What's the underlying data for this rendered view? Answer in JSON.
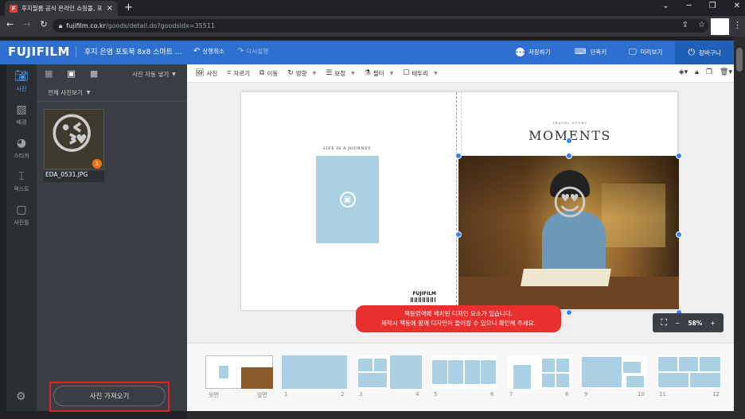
{
  "browser": {
    "tab_title": "후지필름 공식 온라인 쇼핑몰, 포",
    "tab_favicon": "F",
    "tab_close": "×",
    "new_tab": "+",
    "url_domain": "fujifilm.co.kr",
    "url_path": "/goods/detail.do?goodsIdx=35511"
  },
  "header": {
    "logo": "FUJIFILM",
    "product_title": "후지 은염 포토북 8x8 스마트 ...",
    "undo_label": "상행취소",
    "redo_label": "다시실행",
    "save_label": "저장하기",
    "shortcut_label": "단축키",
    "preview_label": "미리보기",
    "cart_label": "장바구니",
    "brand_color": "#2f6fd0"
  },
  "rail": {
    "items": [
      {
        "label": "사진",
        "icon": "camera-icon",
        "active": true
      },
      {
        "label": "배경",
        "icon": "background-icon",
        "active": false
      },
      {
        "label": "스티커",
        "icon": "sticker-icon",
        "active": false
      },
      {
        "label": "텍스트",
        "icon": "text-icon",
        "active": false
      },
      {
        "label": "사진틀",
        "icon": "frame-icon",
        "active": false
      }
    ]
  },
  "panel": {
    "autofill_label": "사진 자동 넣기",
    "view_filter": "전체 사진보기",
    "photos": [
      {
        "filename": "EDA_0531.JPG",
        "badge": "1"
      }
    ],
    "import_button": "사진 가져오기"
  },
  "toolbar": {
    "items": [
      "사진",
      "자르기",
      "이동",
      "방향",
      "보정",
      "필터",
      "테두리"
    ]
  },
  "canvas": {
    "left_title": "LIFE IS A JOURNEY",
    "brand_mark": "FUJIFILM",
    "right_kicker": "TRAVEL STORY",
    "right_title": "MOMENTS",
    "warning_line1": "책등영역에 배치된 디자인 요소가 있습니다.",
    "warning_line2": "제작시 책등에 함께 디자인이 들어갈 수 있으니 확인해 주세요.",
    "zoom_level": "58%"
  },
  "pages": {
    "labels": [
      "뒷면",
      "앞면",
      "1",
      "2",
      "3",
      "4",
      "5",
      "6",
      "7",
      "8",
      "9",
      "10",
      "11",
      "12"
    ]
  }
}
